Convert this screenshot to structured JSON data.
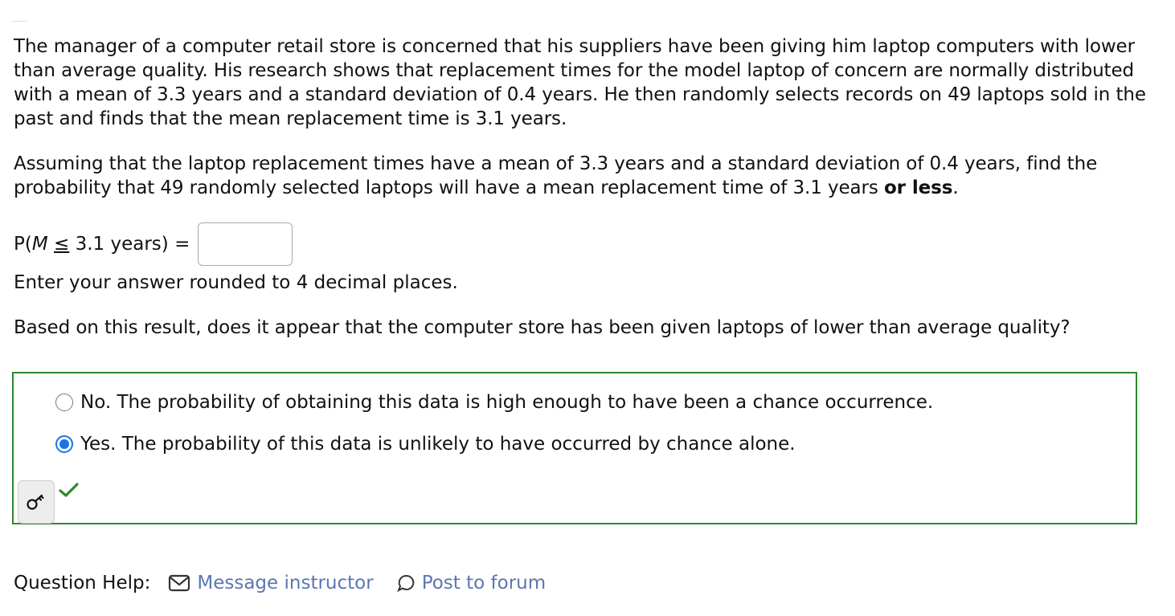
{
  "problem": {
    "intro": "The manager of a computer retail store is concerned that his suppliers have been giving him laptop computers with lower than average quality. His research shows that replacement times for the model laptop of concern are normally distributed with a mean of 3.3 years and a standard deviation of 0.4 years. He then randomly selects records on 49 laptops sold in the past and finds that the mean replacement time is 3.1 years.",
    "task_main": "Assuming that the laptop replacement times have a mean of 3.3 years and a standard deviation of 0.4 years, find the probability that 49 randomly selected laptops will have a mean replacement time of 3.1 years ",
    "task_bold": "or less",
    "task_end": "."
  },
  "equation": {
    "prefix": "P(",
    "variable": "M",
    "operator": "≤",
    "suffix": " 3.1 years)",
    "equals": "=",
    "answer_value": "",
    "answer_placeholder": ""
  },
  "hint": "Enter your answer rounded to 4 decimal places.",
  "question2": "Based on this result, does it appear that the computer store has been given laptops of lower than average quality?",
  "choices": [
    {
      "label": "No. The probability of obtaining this data is high enough to have been a chance occurrence.",
      "selected": false
    },
    {
      "label": "Yes. The probability of this data is unlikely to have occurred by chance alone.",
      "selected": true
    }
  ],
  "status": {
    "correct": true,
    "accent": "#2d8a2d"
  },
  "help": {
    "label": "Question Help:",
    "message_link": "Message instructor",
    "forum_link": "Post to forum",
    "link_color": "#5a77b0"
  }
}
